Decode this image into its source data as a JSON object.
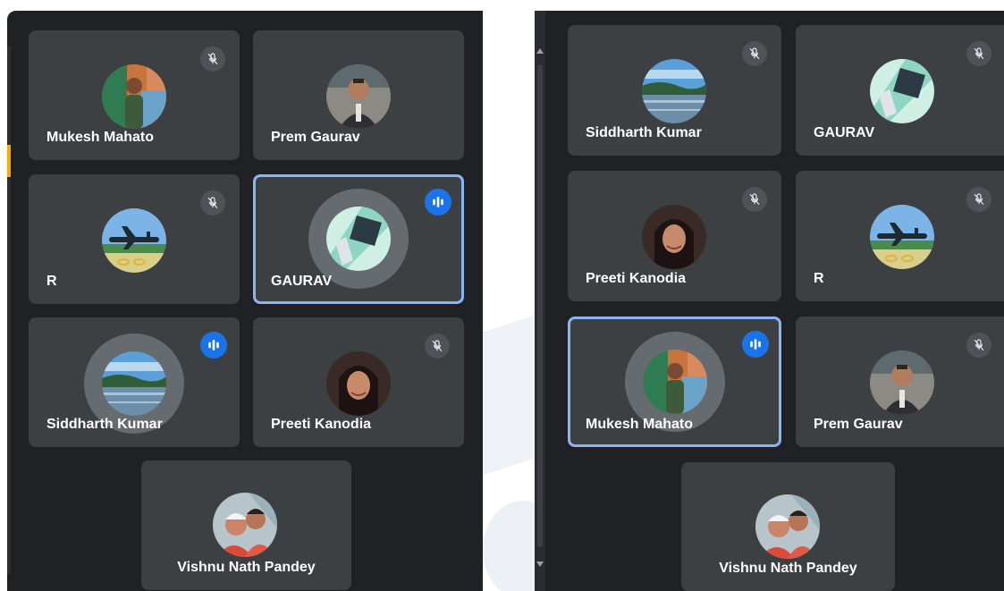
{
  "left_panel": {
    "tiles": [
      {
        "name": "Mukesh Mahato",
        "mic": "mic-off-icon"
      },
      {
        "name": "Prem Gaurav",
        "mic": "none"
      },
      {
        "name": "R",
        "mic": "mic-off-icon"
      },
      {
        "name": "GAURAV",
        "mic": "speaking-indicator-icon",
        "active": true
      },
      {
        "name": "Siddharth Kumar",
        "mic": "speaking-indicator-icon"
      },
      {
        "name": "Preeti Kanodia",
        "mic": "mic-off-icon"
      },
      {
        "name": "Vishnu Nath Pandey",
        "mic": "none"
      }
    ]
  },
  "right_panel": {
    "tiles": [
      {
        "name": "Siddharth Kumar",
        "mic": "mic-off-icon"
      },
      {
        "name": "GAURAV",
        "mic": "mic-off-icon"
      },
      {
        "name": "Preeti Kanodia",
        "mic": "mic-off-icon"
      },
      {
        "name": "R",
        "mic": "mic-off-icon"
      },
      {
        "name": "Mukesh Mahato",
        "mic": "speaking-indicator-icon",
        "active": true
      },
      {
        "name": "Prem Gaurav",
        "mic": "mic-off-icon"
      },
      {
        "name": "Vishnu Nath Pandey",
        "mic": "none"
      }
    ]
  },
  "colors": {
    "background": "#202124",
    "tile": "#3c4043",
    "active_border": "#8ab4f8",
    "speaking_badge": "#1a73e8",
    "text": "#ffffff"
  }
}
